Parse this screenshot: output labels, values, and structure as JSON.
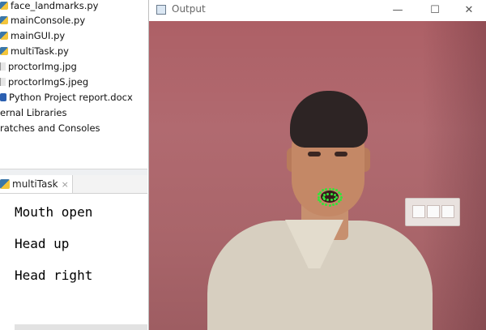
{
  "project_tree": {
    "items": [
      {
        "label": "face_landmarks.py",
        "icon": "python-file-icon"
      },
      {
        "label": "mainConsole.py",
        "icon": "python-file-icon"
      },
      {
        "label": "mainGUI.py",
        "icon": "python-file-icon"
      },
      {
        "label": "multiTask.py",
        "icon": "python-file-icon"
      },
      {
        "label": "proctorImg.jpg",
        "icon": "image-file-icon"
      },
      {
        "label": "proctorImgS.jpeg",
        "icon": "image-file-icon"
      },
      {
        "label": "Python Project report.docx",
        "icon": "word-document-icon"
      },
      {
        "label": "ernal Libraries",
        "icon": ""
      },
      {
        "label": "ratches and Consoles",
        "icon": ""
      }
    ]
  },
  "run_panel": {
    "tab_label": "multiTask",
    "tab_close": "×",
    "output_lines": [
      "Mouth open",
      "Head up",
      "Head right"
    ]
  },
  "output_window": {
    "title": "Output",
    "minimize": "—",
    "maximize": "☐",
    "close": "✕"
  },
  "colors": {
    "landmark": "#36e23a",
    "wall": "#ad6066"
  }
}
